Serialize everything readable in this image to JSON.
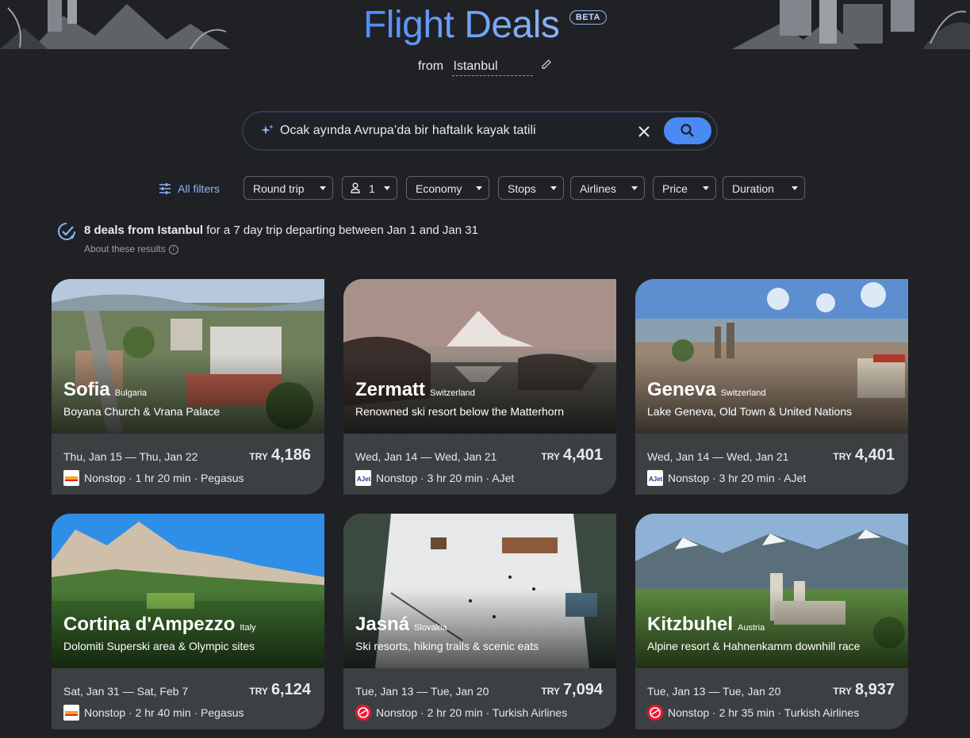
{
  "header": {
    "title": "Flight Deals",
    "badge": "BETA",
    "from_label": "from",
    "origin": "Istanbul"
  },
  "search": {
    "query": "Ocak ayında Avrupa’da bir haftalık kayak tatili"
  },
  "filters": {
    "all_filters": "All filters",
    "chips": [
      "Round trip",
      "1",
      "Economy",
      "Stops",
      "Airlines",
      "Price",
      "Duration"
    ]
  },
  "summary": {
    "bold": "8 deals from Istanbul",
    "rest": "for a 7 day trip departing between Jan 1 and Jan 31",
    "about": "About these results"
  },
  "colors": {
    "accent": "#8ab4f8",
    "search_button": "#4a8af4",
    "background": "#202124",
    "card": "#3c4043"
  },
  "deals": [
    {
      "city": "Sofia",
      "country": "Bulgaria",
      "tagline": "Boyana Church & Vrana Palace",
      "dates": "Thu, Jan 15 — Thu, Jan 22",
      "currency": "TRY",
      "price": "4,186",
      "flight": "Nonstop · 1 hr 20 min · Pegasus",
      "airline_logo": "pegasus-logo"
    },
    {
      "city": "Zermatt",
      "country": "Switzerland",
      "tagline": "Renowned ski resort below the Matterhorn",
      "dates": "Wed, Jan 14 — Wed, Jan 21",
      "currency": "TRY",
      "price": "4,401",
      "flight": "Nonstop · 3 hr 20 min · AJet",
      "airline_logo": "ajet-logo"
    },
    {
      "city": "Geneva",
      "country": "Switzerland",
      "tagline": "Lake Geneva, Old Town & United Nations",
      "dates": "Wed, Jan 14 — Wed, Jan 21",
      "currency": "TRY",
      "price": "4,401",
      "flight": "Nonstop · 3 hr 20 min · AJet",
      "airline_logo": "ajet-logo"
    },
    {
      "city": "Cortina d'Ampezzo",
      "country": "Italy",
      "tagline": "Dolomiti Superski area & Olympic sites",
      "dates": "Sat, Jan 31 — Sat, Feb 7",
      "currency": "TRY",
      "price": "6,124",
      "flight": "Nonstop · 2 hr 40 min · Pegasus",
      "airline_logo": "pegasus-logo"
    },
    {
      "city": "Jasná",
      "country": "Slovakia",
      "tagline": "Ski resorts, hiking trails & scenic eats",
      "dates": "Tue, Jan 13 — Tue, Jan 20",
      "currency": "TRY",
      "price": "7,094",
      "flight": "Nonstop · 2 hr 20 min · Turkish Airlines",
      "airline_logo": "turkish-airlines-logo"
    },
    {
      "city": "Kitzbuhel",
      "country": "Austria",
      "tagline": "Alpine resort & Hahnenkamm downhill race",
      "dates": "Tue, Jan 13 — Tue, Jan 20",
      "currency": "TRY",
      "price": "8,937",
      "flight": "Nonstop · 2 hr 35 min · Turkish Airlines",
      "airline_logo": "turkish-airlines-logo"
    }
  ]
}
